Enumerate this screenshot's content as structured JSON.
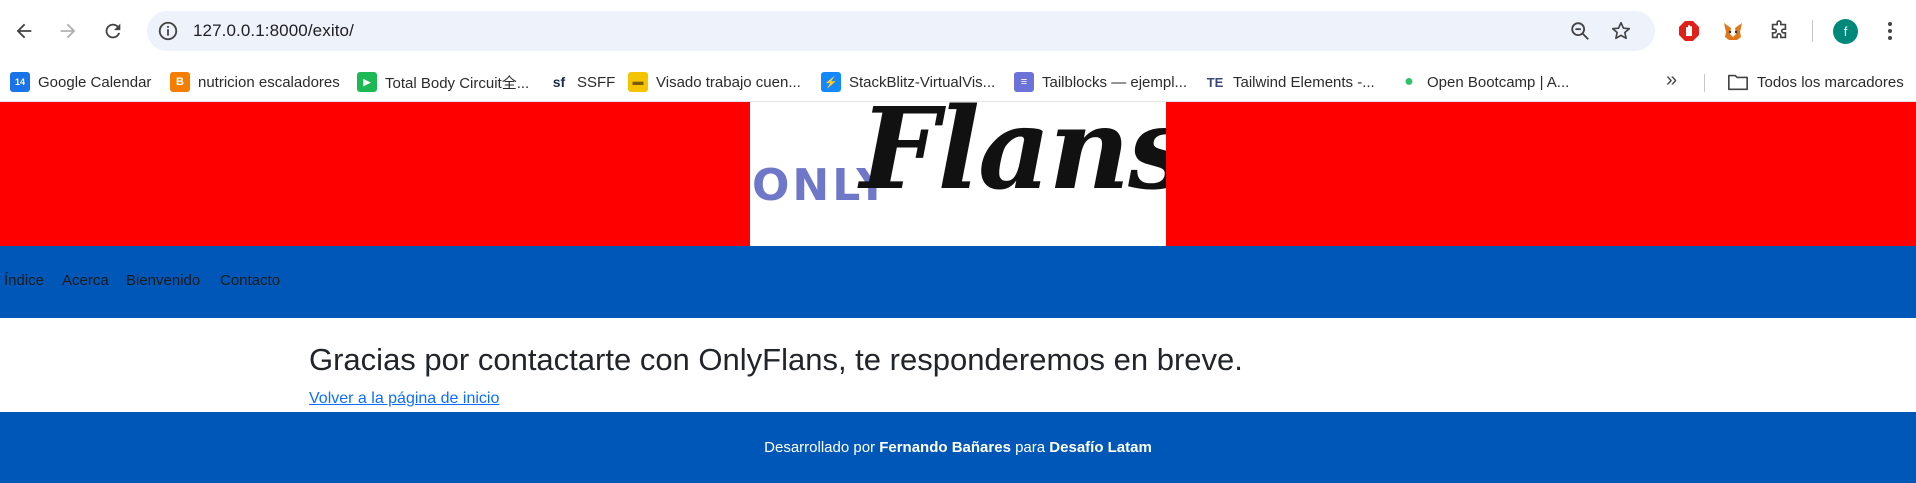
{
  "browser": {
    "url": "127.0.0.1:8000/exito/",
    "profile_initial": "f",
    "bookmarks": [
      {
        "label": "Google Calendar",
        "icon": "calendar-icon",
        "color": "#1a73e8",
        "glyph": "14"
      },
      {
        "label": "nutricion escaladores",
        "icon": "blogger-icon",
        "color": "#f57d00",
        "glyph": "B"
      },
      {
        "label": "Total Body Circuit全...",
        "icon": "video-icon",
        "color": "#1db954",
        "glyph": "▶"
      },
      {
        "label": "SSFF",
        "icon": "sf-icon",
        "color": "#1c2a4a",
        "glyph": "sf"
      },
      {
        "label": "Visado trabajo cuen...",
        "icon": "document-icon",
        "color": "#f5c400",
        "glyph": "▬"
      },
      {
        "label": "StackBlitz-VirtualVis...",
        "icon": "stackblitz-icon",
        "color": "#1389fd",
        "glyph": "⚡"
      },
      {
        "label": "Tailblocks — ejempl...",
        "icon": "tailblocks-icon",
        "color": "#6b73d8",
        "glyph": "≡"
      },
      {
        "label": "Tailwind Elements -...",
        "icon": "tailwind-elements-icon",
        "color": "#3b4a7a",
        "glyph": "TE"
      },
      {
        "label": "Open Bootcamp | A...",
        "icon": "bootcamp-icon",
        "color": "#2fc26b",
        "glyph": "●"
      }
    ],
    "all_bookmarks_label": "Todos los marcadores"
  },
  "header": {
    "logo_only": "ONLY",
    "logo_flans": "Flans",
    "colors": {
      "header_bg": "#ff0000",
      "logo_bg": "#ffffff",
      "logo_only": "#6f78c8"
    }
  },
  "nav": {
    "items": [
      "Índice",
      "Acerca",
      "Bienvenido",
      "Contacto"
    ],
    "color": "#0057b8"
  },
  "main": {
    "title": "Gracias por contactarte con OnlyFlans, te responderemos en breve.",
    "home_link": "Volver a la página de inicio"
  },
  "footer": {
    "prefix": "Desarrollado por",
    "author": "Fernando Bañares",
    "middle": "para",
    "org": "Desafío Latam",
    "color": "#0057b8"
  }
}
